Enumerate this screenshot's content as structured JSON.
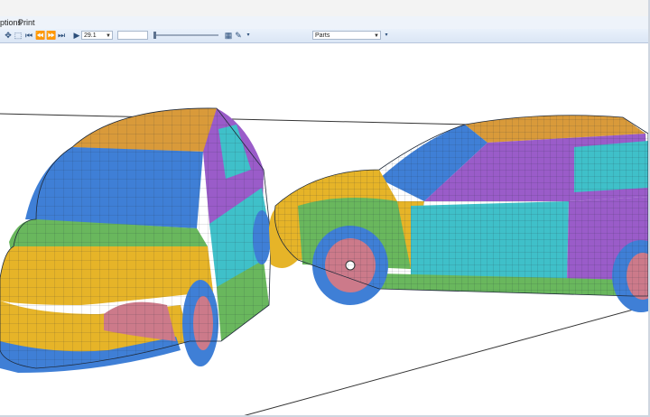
{
  "menu": {
    "items": [
      "ptions",
      "Print"
    ]
  },
  "toolbar": {
    "frame_value": "29.1",
    "secondary_value": "",
    "view_select": "Parts",
    "icons": [
      "arrow-select-icon",
      "cursor-icon",
      "step-back-icon",
      "step-prev-icon",
      "step-next-icon",
      "step-forward-icon",
      "play-icon",
      "camera-icon",
      "tools-icon",
      "caret-icon"
    ]
  },
  "scene": {
    "description_colors": {
      "yellow": "#e6b428",
      "blue": "#3f7fd6",
      "purple": "#9a5cc9",
      "green": "#69b75d",
      "cyan": "#3fc0c9",
      "orange": "#d99a3a",
      "pink": "#cc7a8a"
    }
  }
}
